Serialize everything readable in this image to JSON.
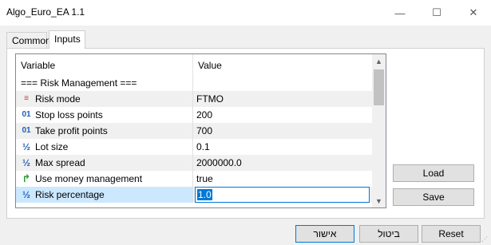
{
  "window": {
    "title": "Algo_Euro_EA 1.1",
    "controls": {
      "minimize": "—",
      "maximize": "☐",
      "close": "✕"
    }
  },
  "tabs": [
    {
      "label": "Common",
      "active": false
    },
    {
      "label": "Inputs",
      "active": true
    }
  ],
  "grid": {
    "headers": {
      "variable": "Variable",
      "value": "Value"
    },
    "rows": [
      {
        "icon": "none",
        "variable": "=== Risk Management ===",
        "value": ""
      },
      {
        "icon": "enum-icon",
        "variable": "Risk mode",
        "value": "FTMO"
      },
      {
        "icon": "integer-icon",
        "variable": "Stop loss points",
        "value": "200"
      },
      {
        "icon": "integer-icon",
        "variable": "Take profit points",
        "value": "700"
      },
      {
        "icon": "double-icon",
        "variable": "Lot size",
        "value": "0.1"
      },
      {
        "icon": "double-icon",
        "variable": "Max spread",
        "value": "2000000.0"
      },
      {
        "icon": "bool-icon",
        "variable": "Use money management",
        "value": "true"
      },
      {
        "icon": "double-icon",
        "variable": "Risk percentage",
        "value": "1.0"
      }
    ],
    "icon_glyphs": {
      "integer": "01",
      "double": "½",
      "bool": "↱",
      "enum": "≡"
    }
  },
  "side_buttons": {
    "load": "Load",
    "save": "Save"
  },
  "bottom_buttons": {
    "ok": "אישור",
    "cancel": "ביטול",
    "reset": "Reset"
  },
  "colors": {
    "accent": "#0078d7",
    "row_alt": "#f0f0f0",
    "selection": "#cce8ff"
  }
}
